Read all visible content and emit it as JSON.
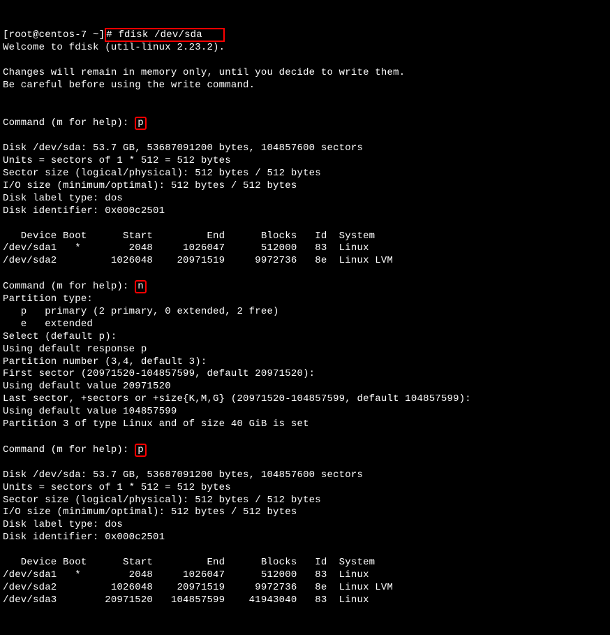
{
  "prompt": {
    "prefix": "[root@centos-7 ~]",
    "hash": "#",
    "command": "fdisk /dev/sda"
  },
  "intro": {
    "welcome": "Welcome to fdisk (util-linux 2.23.2).",
    "notice1": "Changes will remain in memory only, until you decide to write them.",
    "notice2": "Be careful before using the write command."
  },
  "cmd1": {
    "label": "Command (m for help): ",
    "value": "p"
  },
  "diskinfo1": {
    "l1": "Disk /dev/sda: 53.7 GB, 53687091200 bytes, 104857600 sectors",
    "l2": "Units = sectors of 1 * 512 = 512 bytes",
    "l3": "Sector size (logical/physical): 512 bytes / 512 bytes",
    "l4": "I/O size (minimum/optimal): 512 bytes / 512 bytes",
    "l5": "Disk label type: dos",
    "l6": "Disk identifier: 0x000c2501"
  },
  "table1": {
    "header": "   Device Boot      Start         End      Blocks   Id  System",
    "r1": "/dev/sda1   *        2048     1026047      512000   83  Linux",
    "r2": "/dev/sda2         1026048    20971519     9972736   8e  Linux LVM"
  },
  "cmd2": {
    "label": "Command (m for help): ",
    "value": "n"
  },
  "partop": {
    "l1": "Partition type:",
    "l2": "   p   primary (2 primary, 0 extended, 2 free)",
    "l3": "   e   extended",
    "l4": "Select (default p):",
    "l5": "Using default response p",
    "l6": "Partition number (3,4, default 3):",
    "l7": "First sector (20971520-104857599, default 20971520):",
    "l8": "Using default value 20971520",
    "l9": "Last sector, +sectors or +size{K,M,G} (20971520-104857599, default 104857599):",
    "l10": "Using default value 104857599",
    "l11": "Partition 3 of type Linux and of size 40 GiB is set"
  },
  "cmd3": {
    "label": "Command (m for help): ",
    "value": "p"
  },
  "diskinfo2": {
    "l1": "Disk /dev/sda: 53.7 GB, 53687091200 bytes, 104857600 sectors",
    "l2": "Units = sectors of 1 * 512 = 512 bytes",
    "l3": "Sector size (logical/physical): 512 bytes / 512 bytes",
    "l4": "I/O size (minimum/optimal): 512 bytes / 512 bytes",
    "l5": "Disk label type: dos",
    "l6": "Disk identifier: 0x000c2501"
  },
  "table2": {
    "header": "   Device Boot      Start         End      Blocks   Id  System",
    "r1": "/dev/sda1   *        2048     1026047      512000   83  Linux",
    "r2": "/dev/sda2         1026048    20971519     9972736   8e  Linux LVM",
    "r3": "/dev/sda3        20971520   104857599    41943040   83  Linux"
  }
}
